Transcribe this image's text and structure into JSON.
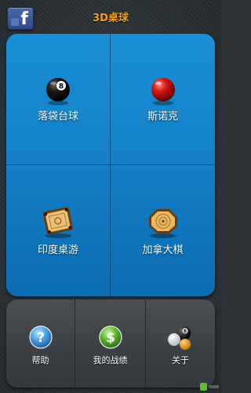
{
  "header": {
    "facebook_label": "f",
    "title": "3D桌球"
  },
  "menu": {
    "items": [
      {
        "label": "落袋台球",
        "icon": "eight-ball-icon"
      },
      {
        "label": "斯诺克",
        "icon": "red-ball-icon"
      },
      {
        "label": "印度桌游",
        "icon": "carrom-board-icon"
      },
      {
        "label": "加拿大棋",
        "icon": "crokinole-board-icon"
      }
    ]
  },
  "bottom": {
    "items": [
      {
        "label": "帮助",
        "icon": "help-icon"
      },
      {
        "label": "我的战绩",
        "icon": "dollar-icon"
      },
      {
        "label": "关于",
        "icon": "about-balls-icon"
      }
    ]
  },
  "colors": {
    "title": "#f0a020",
    "panel": "#137fc6",
    "bottom_panel": "#3a3f43",
    "facebook": "#3b5998"
  }
}
